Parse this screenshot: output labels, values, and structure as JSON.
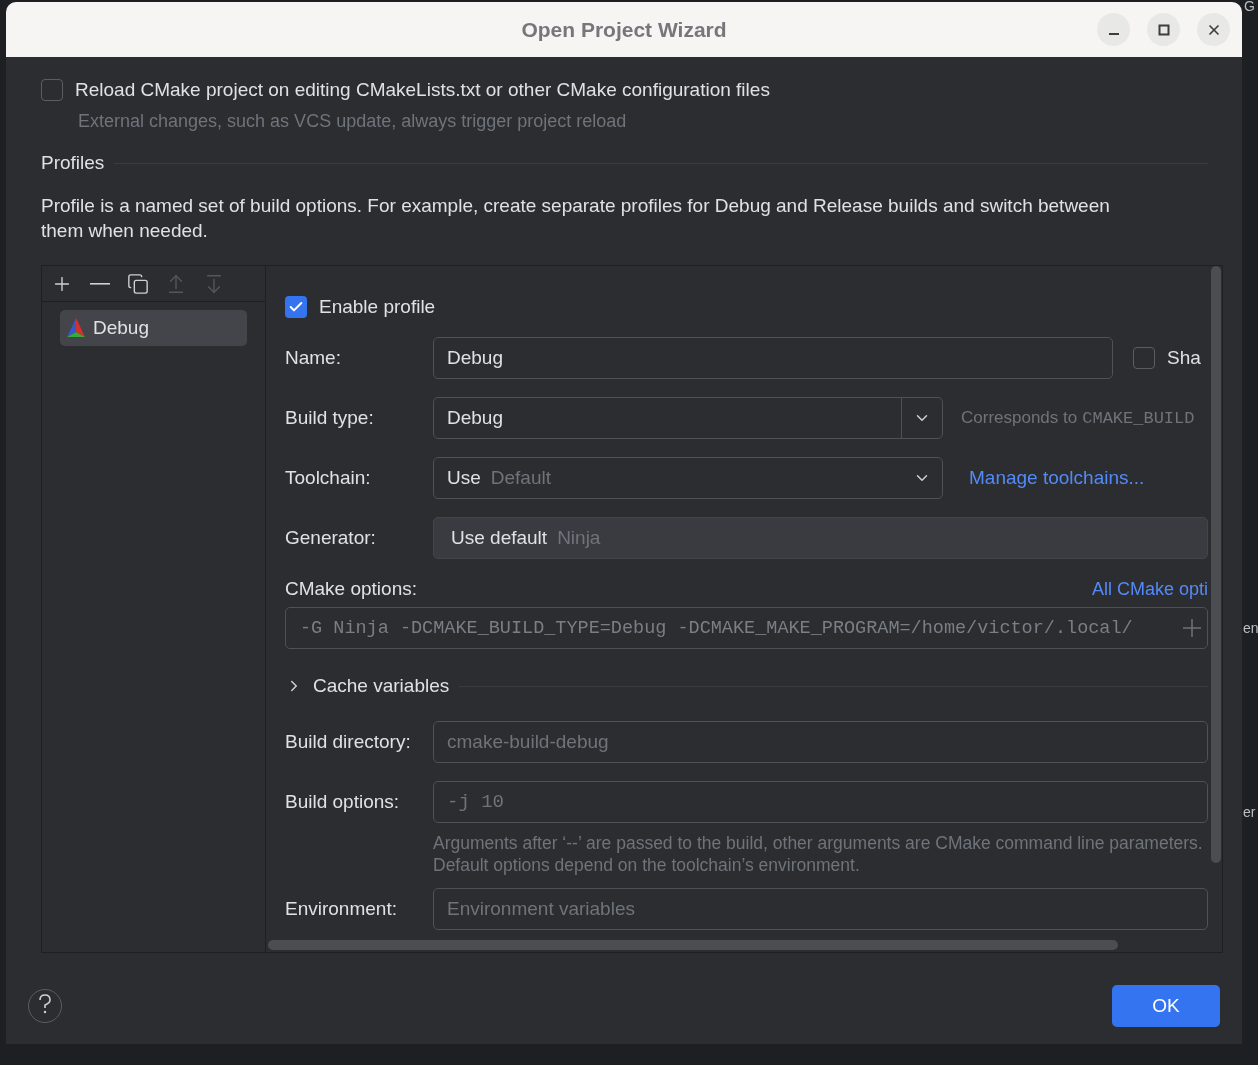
{
  "window": {
    "title": "Open Project Wizard"
  },
  "background_fragments": [
    "G",
    "en",
    "er"
  ],
  "reload_option": {
    "label": "Reload CMake project on editing CMakeLists.txt or other CMake configuration files",
    "checked": false,
    "hint": "External changes, such as VCS update, always trigger project reload"
  },
  "profiles_section": {
    "title": "Profiles",
    "description": "Profile is a named set of build options. For example, create separate profiles for Debug and Release builds and switch between them when needed."
  },
  "toolbar": [
    {
      "kind": "add",
      "disabled": false
    },
    {
      "kind": "remove",
      "disabled": false
    },
    {
      "kind": "copy",
      "disabled": false
    },
    {
      "kind": "up",
      "disabled": true
    },
    {
      "kind": "down",
      "disabled": true
    }
  ],
  "profiles": [
    {
      "name": "Debug",
      "selected": true
    }
  ],
  "form": {
    "enable_profile": {
      "label": "Enable profile",
      "checked": true
    },
    "name": {
      "label": "Name:",
      "value": "Debug",
      "share_label": "Sha",
      "share_checked": false
    },
    "build_type": {
      "label": "Build type:",
      "value": "Debug",
      "hint": "Corresponds to",
      "hint_code": "CMAKE_BUILD"
    },
    "toolchain": {
      "label": "Toolchain:",
      "value": "Use",
      "default": "Default",
      "link": "Manage toolchains..."
    },
    "generator": {
      "label": "Generator:",
      "value": "Use default",
      "default": "Ninja"
    },
    "cmake_options": {
      "label": "CMake options:",
      "link": "All CMake opti",
      "value": "-G Ninja -DCMAKE_BUILD_TYPE=Debug -DCMAKE_MAKE_PROGRAM=/home/victor/.local/"
    },
    "cache_variables": {
      "label": "Cache variables",
      "expanded": false
    },
    "build_directory": {
      "label": "Build directory:",
      "placeholder": "cmake-build-debug"
    },
    "build_options": {
      "label": "Build options:",
      "placeholder": "-j 10",
      "hint": "Arguments after ‘--’ are passed to the build, other arguments are CMake command line parameters. Default options depend on the toolchain’s environment."
    },
    "environment": {
      "label": "Environment:",
      "placeholder": "Environment variables"
    }
  },
  "buttons": [
    {
      "label": "OK"
    }
  ]
}
